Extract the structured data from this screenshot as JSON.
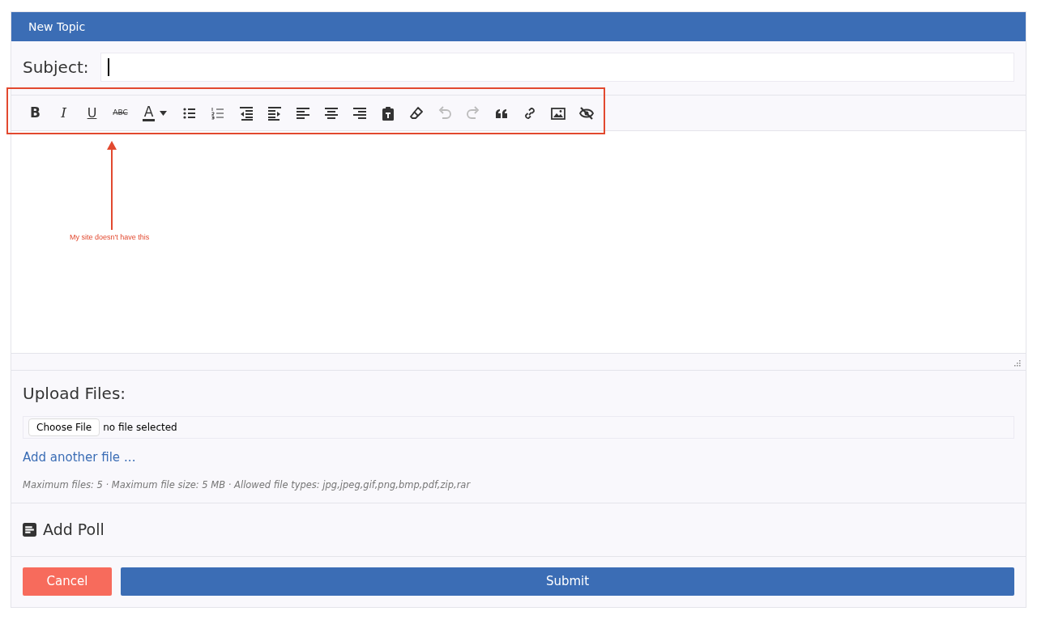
{
  "header": {
    "title": "New Topic"
  },
  "subject": {
    "label": "Subject:"
  },
  "toolbar": [
    {
      "kind": "text",
      "label": "B",
      "disabled": false
    },
    {
      "kind": "text",
      "label": "I",
      "disabled": false
    },
    {
      "kind": "text",
      "label": "U",
      "disabled": false
    },
    {
      "kind": "text",
      "label": "ABC",
      "disabled": false
    },
    {
      "kind": "color",
      "label": "A",
      "disabled": false
    },
    {
      "kind": "icon",
      "disabled": false
    },
    {
      "kind": "icon",
      "disabled": false
    },
    {
      "kind": "icon",
      "disabled": false
    },
    {
      "kind": "icon",
      "disabled": false
    },
    {
      "kind": "icon",
      "disabled": false
    },
    {
      "kind": "icon",
      "disabled": false
    },
    {
      "kind": "icon",
      "disabled": false
    },
    {
      "kind": "icon",
      "disabled": false
    },
    {
      "kind": "icon",
      "disabled": false
    },
    {
      "kind": "icon",
      "disabled": true
    },
    {
      "kind": "icon",
      "disabled": true
    },
    {
      "kind": "icon",
      "disabled": false
    },
    {
      "kind": "icon",
      "disabled": false
    },
    {
      "kind": "icon",
      "disabled": false
    },
    {
      "kind": "icon",
      "disabled": false
    }
  ],
  "annotation": {
    "text": "My site doesn't have this"
  },
  "upload": {
    "title": "Upload Files:",
    "choose_button": "Choose File",
    "file_status": "no file selected",
    "add_link": "Add another file",
    "add_suffix": "...",
    "note": "Maximum files: 5 · Maximum file size: 5 MB · Allowed file types: jpg,jpeg,gif,png,bmp,pdf,zip,rar"
  },
  "poll": {
    "label": "Add Poll"
  },
  "buttons": {
    "cancel": "Cancel",
    "submit": "Submit"
  }
}
